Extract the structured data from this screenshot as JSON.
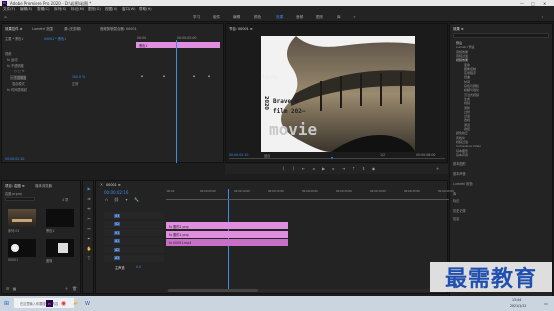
{
  "window": {
    "title": "Adobe Premiere Pro 2020 - D:\\岩图\\岩图 *"
  },
  "menu": [
    "文件(F)",
    "编辑(E)",
    "剪辑(C)",
    "序列(S)",
    "标记(M)",
    "图形(G)",
    "视图(V)",
    "窗口(W)",
    "帮助(H)"
  ],
  "workspaces": [
    "学习",
    "组件",
    "编辑",
    "颜色",
    "效果",
    "音频",
    "图形",
    "库"
  ],
  "effect_controls": {
    "tabs": [
      "效果控件 ≡",
      "Lumetri 范围",
      "源:(无剪辑)",
      "音频剪辑混合器: 00001"
    ],
    "master": "主要 * 黑色1",
    "seq": "00001 * 黑色1",
    "clip_label": "黑色1",
    "time_start": "00:00",
    "time_mid": "00:00:05:00",
    "rows": [
      "视频",
      "fx 运动",
      "fx 不透明度",
      "○ □ ✎",
      "→ 不透明度",
      "混合模式",
      "fx 时间重映射"
    ],
    "opacity_value": "100.0 %",
    "blend_value": "正常",
    "timecode": "00:00:02:10"
  },
  "program": {
    "tab": "节目: 00001 ≡",
    "timecode_left": "00:00:02:10",
    "fit": "适合",
    "scale": "1/2",
    "timecode_right": "00:00:08:00",
    "overlay_small": "Hero",
    "overlay_line1": "Brave 0",
    "overlay_line2": "film 202—",
    "overlay_big": "movie",
    "overlay_vertical": "2020"
  },
  "effects": {
    "tab": "效果 ≡",
    "items": [
      "预设",
      "Lumetri 预设",
      "音频效果",
      "音频过渡",
      "视频效果",
      "变换",
      "图像控制",
      "实用程序",
      "扭曲",
      "时间",
      "杂色与颗粒",
      "模糊与锐化",
      "沉浸式视频",
      "生成",
      "视频",
      "调整",
      "过时",
      "过渡",
      "透视",
      "通道",
      "键控",
      "颜色校正",
      "风格化",
      "视频过渡",
      "Immersive Video",
      "基本图形",
      "基本声音"
    ],
    "right_labels": [
      "基本图形",
      "基本声音",
      "Lumetri 颜色",
      "库",
      "标记",
      "历史记录",
      "信息"
    ]
  },
  "project": {
    "tabs": [
      "项目: 岩图 ≡",
      "媒体浏览器"
    ],
    "name": "岩图.prproj",
    "thumbs": [
      "序列 01",
      "黑色1",
      "00001",
      "图像"
    ],
    "count": "4 项"
  },
  "timeline": {
    "tab": "00001 ≡",
    "timecode": "00:00:02:10",
    "ruler": [
      ":00:00",
      "00:00:05:00",
      "00:00:10:00",
      "00:00:15:00",
      "00:00:20:00",
      "00:00:25:00",
      "00:00:30:00",
      "00:00:35:00",
      "00:00:40:00"
    ],
    "tracks": [
      "V3",
      "V2",
      "V1",
      "A1",
      "A2",
      "A3",
      "主声道"
    ],
    "master_value": "0.0",
    "clips": [
      {
        "label": "fx 图形2.png",
        "track": 1
      },
      {
        "label": "fx 图形1.png",
        "track": 2
      },
      {
        "label": "fx 00001.mp4",
        "track": 3
      }
    ]
  },
  "taskbar": {
    "search": "在这里输入你要搜索的内容",
    "time": "13:44",
    "date": "2021/1/12",
    "brand": "最需教育"
  }
}
